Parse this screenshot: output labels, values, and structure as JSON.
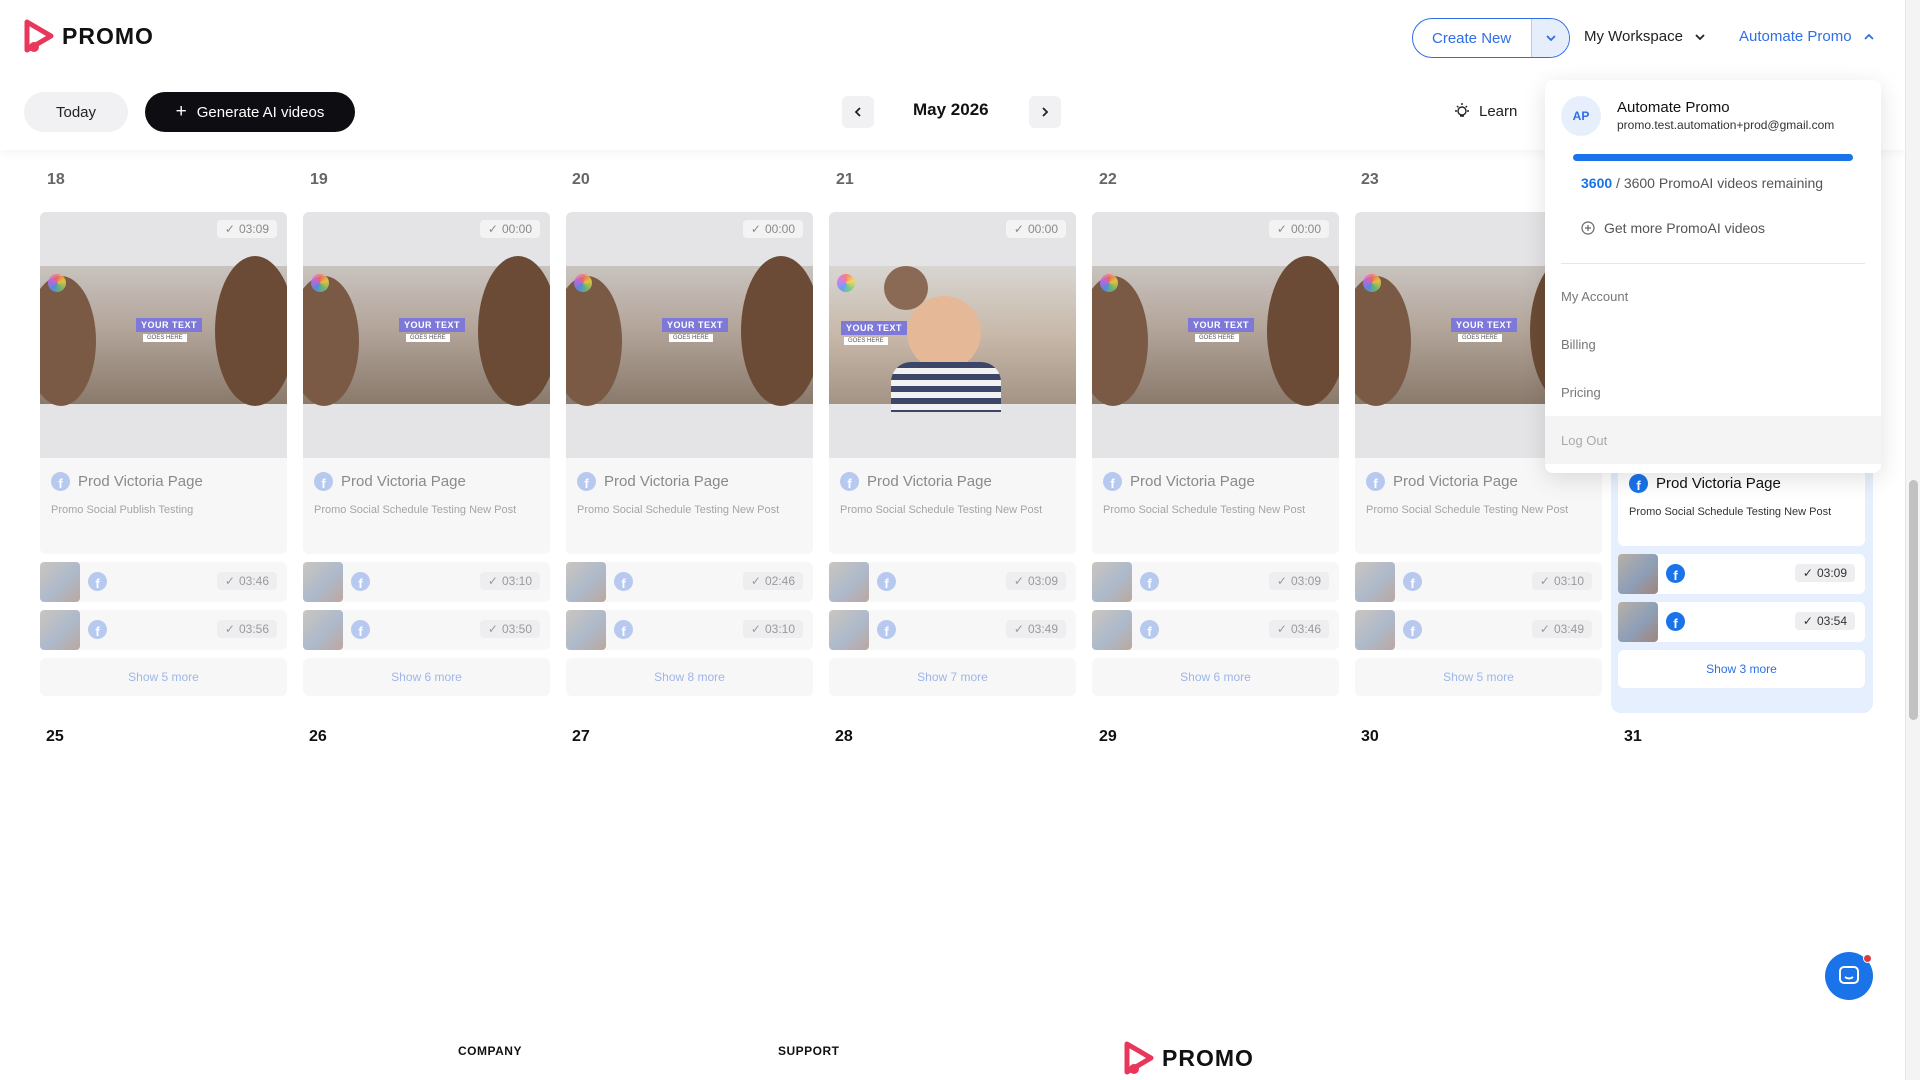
{
  "header": {
    "logo_text": "PROMO",
    "create_new_label": "Create New",
    "workspace_label": "My Workspace",
    "account_label": "Automate Promo"
  },
  "toolbar": {
    "today_label": "Today",
    "generate_label": "Generate AI videos",
    "month_label": "May 2026",
    "learn_label": "Learn"
  },
  "week1": {
    "days": [
      "18",
      "19",
      "20",
      "21",
      "22",
      "23"
    ],
    "columns": [
      {
        "duration": "03:09",
        "page_name": "Prod Victoria Page",
        "post_title": "Promo Social Publish Testing",
        "mini": [
          "03:46",
          "03:56"
        ],
        "show_more": "Show 5 more"
      },
      {
        "duration": "00:00",
        "page_name": "Prod Victoria Page",
        "post_title": "Promo Social Schedule Testing New Post",
        "mini": [
          "03:10",
          "03:50"
        ],
        "show_more": "Show 6 more"
      },
      {
        "duration": "00:00",
        "page_name": "Prod Victoria Page",
        "post_title": "Promo Social Schedule Testing New Post",
        "mini": [
          "02:46",
          "03:10"
        ],
        "show_more": "Show 8 more"
      },
      {
        "duration": "00:00",
        "page_name": "Prod Victoria Page",
        "post_title": "Promo Social Schedule Testing New Post",
        "mini": [
          "03:09",
          "03:49"
        ],
        "show_more": "Show 7 more"
      },
      {
        "duration": "00:00",
        "page_name": "Prod Victoria Page",
        "post_title": "Promo Social Schedule Testing New Post",
        "mini": [
          "03:09",
          "03:46"
        ],
        "show_more": "Show 6 more"
      },
      {
        "duration": "",
        "page_name": "Prod Victoria Page",
        "post_title": "Promo Social Schedule Testing New Post",
        "mini": [
          "03:10",
          "03:49"
        ],
        "show_more": "Show 5 more"
      },
      {
        "page_name": "Prod Victoria Page",
        "post_title": "Promo Social Schedule Testing New Post",
        "mini": [
          "03:09",
          "03:54"
        ],
        "show_more": "Show 3 more"
      }
    ],
    "video_overlay_line1": "YOUR TEXT",
    "video_overlay_line2": "GOES HERE"
  },
  "week2": {
    "days": [
      "25",
      "26",
      "27",
      "28",
      "29",
      "30",
      "31"
    ]
  },
  "dropdown": {
    "avatar_initials": "AP",
    "name": "Automate Promo",
    "email": "promo.test.automation+prod@gmail.com",
    "quota_used": "3600",
    "quota_rest": " / 3600 PromoAI videos remaining",
    "quota_fraction": 1.0,
    "get_more_label": "Get more PromoAI videos",
    "items": [
      "My Account",
      "Billing",
      "Pricing",
      "Log Out"
    ]
  },
  "footer": {
    "company_label": "COMPANY",
    "support_label": "SUPPORT",
    "logo_text": "PROMO"
  },
  "colors": {
    "accent": "#2f6ee5",
    "facebook": "#1a73e8",
    "brand_red": "#e8375a"
  }
}
